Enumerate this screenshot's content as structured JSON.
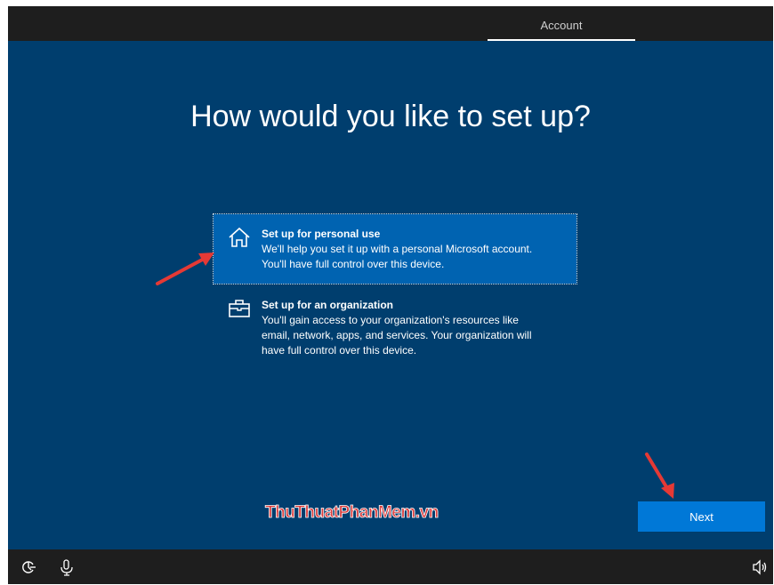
{
  "header": {
    "active_tab": "Account"
  },
  "main": {
    "title": "How would you like to set up?",
    "options": [
      {
        "title": "Set up for personal use",
        "description_lines": [
          "We'll help you set it up with a personal Microsoft account.",
          "You'll have full control over this device."
        ],
        "icon": "home-icon",
        "selected": true
      },
      {
        "title": "Set up for an organization",
        "description_lines": [
          "You'll gain access to your organization's resources like",
          "email, network, apps, and services. Your organization will",
          "have full control over this device."
        ],
        "icon": "briefcase-icon",
        "selected": false
      }
    ]
  },
  "watermark": "ThuThuatPhanMem.vn",
  "footer": {
    "next_label": "Next",
    "icons": [
      "accessibility-icon",
      "microphone-icon",
      "volume-icon"
    ]
  },
  "colors": {
    "background": "#003e6e",
    "selected_option": "#0063b1",
    "button": "#0078d7",
    "bars": "#1e1e1e",
    "annotation_arrow": "#e53935"
  }
}
